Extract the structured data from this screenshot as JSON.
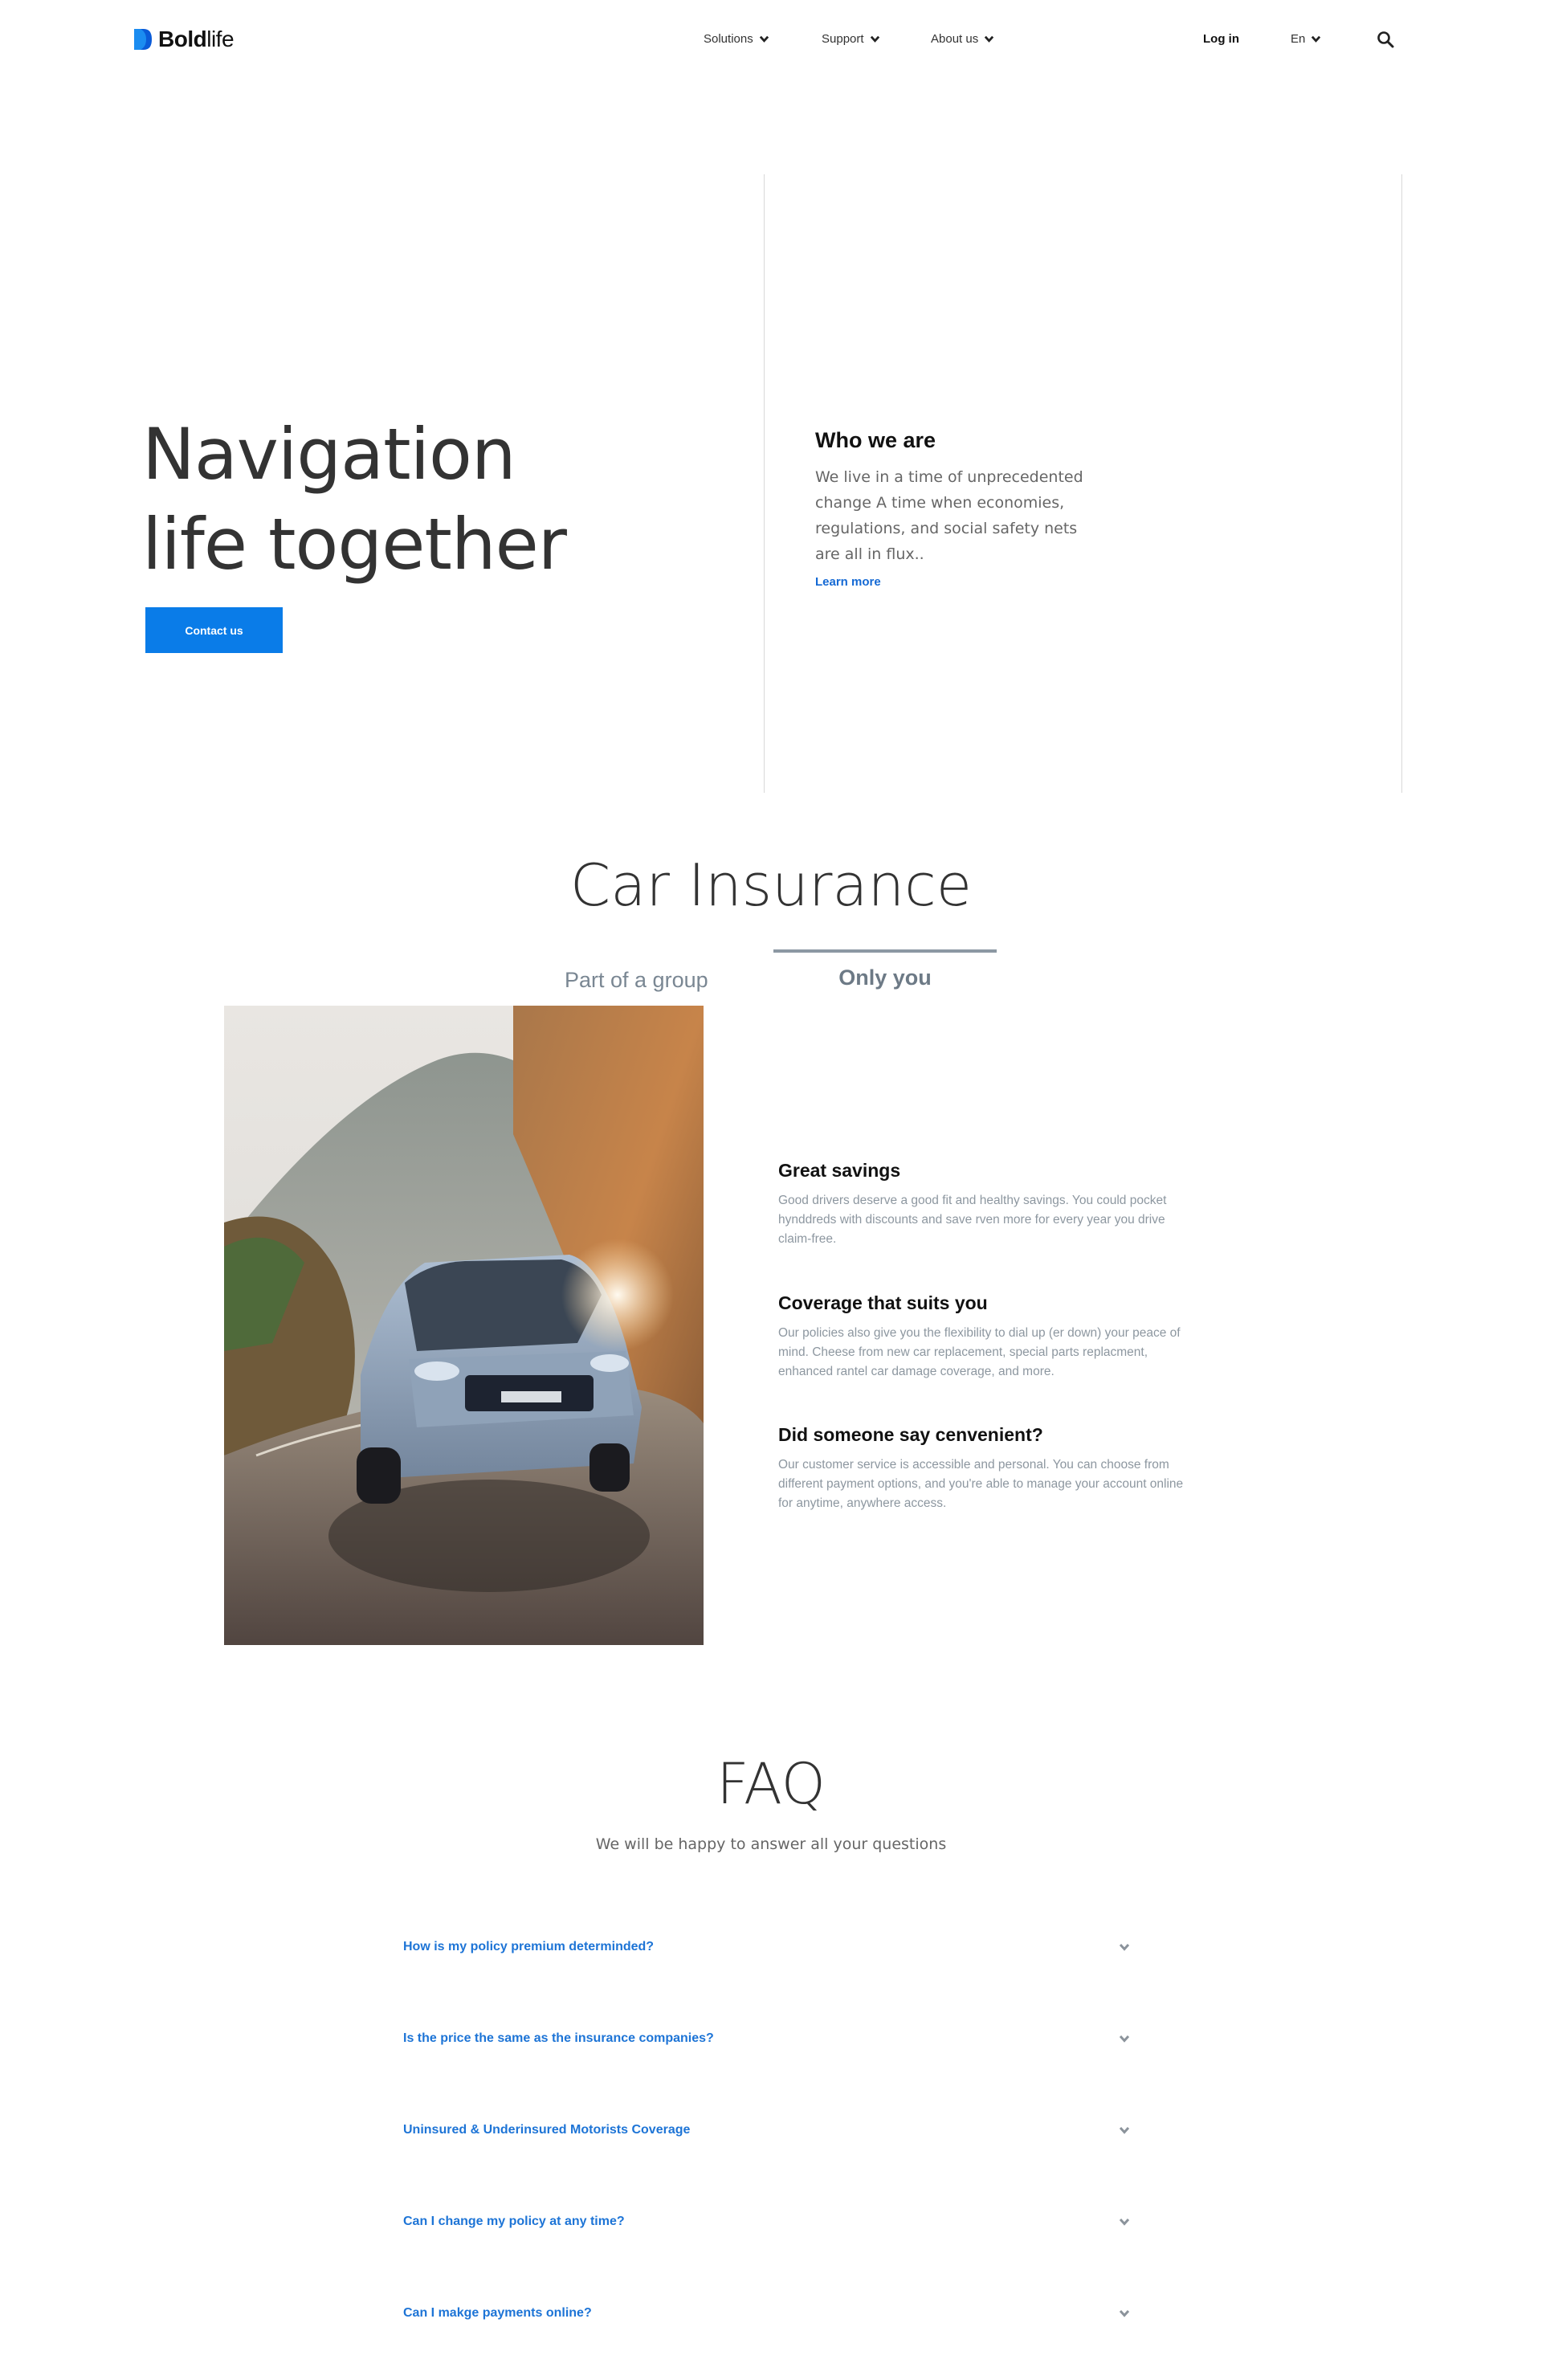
{
  "header": {
    "logo": {
      "bold": "Bold",
      "light": "life",
      "icon": "logo-mark-icon"
    },
    "nav": [
      {
        "label": "Solutions",
        "icon": "chevron-down-icon"
      },
      {
        "label": "Support",
        "icon": "chevron-down-icon"
      },
      {
        "label": "About us",
        "icon": "chevron-down-icon"
      }
    ],
    "login": "Log in",
    "language": "En",
    "search_icon": "search-icon"
  },
  "hero": {
    "title_line1": "Navigation",
    "title_line2": "life together",
    "cta": "Contact us",
    "who_title": "Who we are",
    "who_text": "We live in a time of unprecedented change A time when economies, regulations, and social safety nets are all in flux..",
    "who_link": "Learn more"
  },
  "car_insurance": {
    "title": "Car Insurance",
    "tabs": [
      {
        "label": "Part of a group",
        "active": false
      },
      {
        "label": "Only you",
        "active": true
      }
    ],
    "features": [
      {
        "title": "Great savings",
        "text": "Good drivers deserve a good fit and healthy savings. You could pocket hynddreds with discounts and save rven more for every year you drive claim-free."
      },
      {
        "title": "Coverage that suits you",
        "text": "Our policies also give you the flexibility to dial up (er down) your peace of mind. Cheese from new car replacement, special parts replacment, enhanced rantel car damage coverage, and more."
      },
      {
        "title": "Did someone say cenvenient?",
        "text": "Our customer service is accessible and personal. You can choose from different payment options, and you're able to manage your account online for anytime, anywhere access."
      }
    ]
  },
  "faq": {
    "title": "FAQ",
    "subtitle": "We will be happy to answer all your questions",
    "items": [
      "How is my policy premium determinded?",
      "Is the price the same as the insurance companies?",
      "Uninsured & Underinsured Motorists Coverage",
      "Can I change my policy at any time?",
      "Can I makge payments online?"
    ]
  },
  "colors": {
    "accent": "#0a7ce8",
    "link": "#1d74d6",
    "muted": "#8d97a0"
  }
}
